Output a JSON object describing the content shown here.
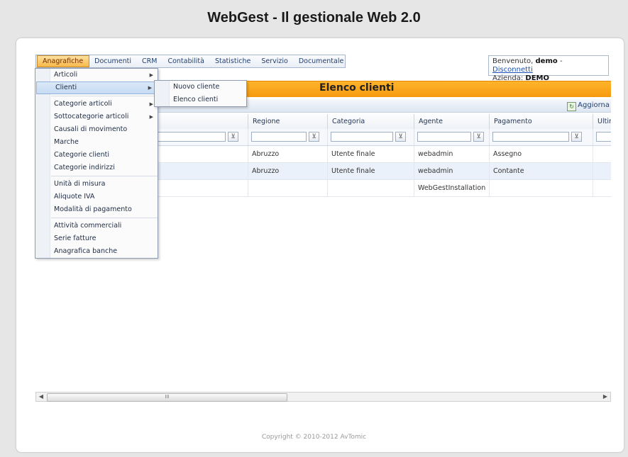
{
  "app": {
    "title": "WebGest - Il gestionale Web 2.0",
    "footer": "Copyright © 2010-2012 AvTomic"
  },
  "menubar": {
    "items": [
      {
        "label": "Anagrafiche",
        "active": true
      },
      {
        "label": "Documenti"
      },
      {
        "label": "CRM"
      },
      {
        "label": "Contabilità"
      },
      {
        "label": "Statistiche"
      },
      {
        "label": "Servizio"
      },
      {
        "label": "Documentale"
      }
    ]
  },
  "welcome": {
    "greeting": "Benvenuto,",
    "user": "demo",
    "separator": "-",
    "logout": "Disconnetti",
    "company_label": "Azienda:",
    "company": "DEMO"
  },
  "page_title": "Elenco clienti",
  "toolbar": {
    "refresh_label": "Aggiorna"
  },
  "grid": {
    "columns": [
      "",
      "Regione",
      "Categoria",
      "Agente",
      "Pagamento",
      "Ultim"
    ],
    "rows": [
      [
        "",
        "Abruzzo",
        "Utente finale",
        "webadmin",
        "Assegno",
        ""
      ],
      [
        "",
        "Abruzzo",
        "Utente finale",
        "webadmin",
        "Contante",
        ""
      ],
      [
        "",
        "",
        "",
        "WebGestInstallation",
        "",
        ""
      ]
    ]
  },
  "dropdown": {
    "items": [
      {
        "label": "Articoli",
        "submenu": true
      },
      {
        "label": "Clienti",
        "submenu": true,
        "highlight": true
      },
      {
        "label": "Categorie articoli",
        "submenu": true
      },
      {
        "label": "Sottocategorie articoli",
        "submenu": true
      },
      {
        "label": "Causali di movimento"
      },
      {
        "label": "Marche"
      },
      {
        "label": "Categorie clienti"
      },
      {
        "label": "Categorie indirizzi"
      },
      {
        "label": "Unità di misura"
      },
      {
        "label": "Aliquote IVA"
      },
      {
        "label": "Modalità di pagamento"
      },
      {
        "label": "Attività commerciali"
      },
      {
        "label": "Serie fatture"
      },
      {
        "label": "Anagrafica banche"
      }
    ]
  },
  "submenu": {
    "items": [
      {
        "label": "Nuovo cliente"
      },
      {
        "label": "Elenco clienti"
      }
    ]
  },
  "scrollbar": {
    "grip": "III"
  }
}
